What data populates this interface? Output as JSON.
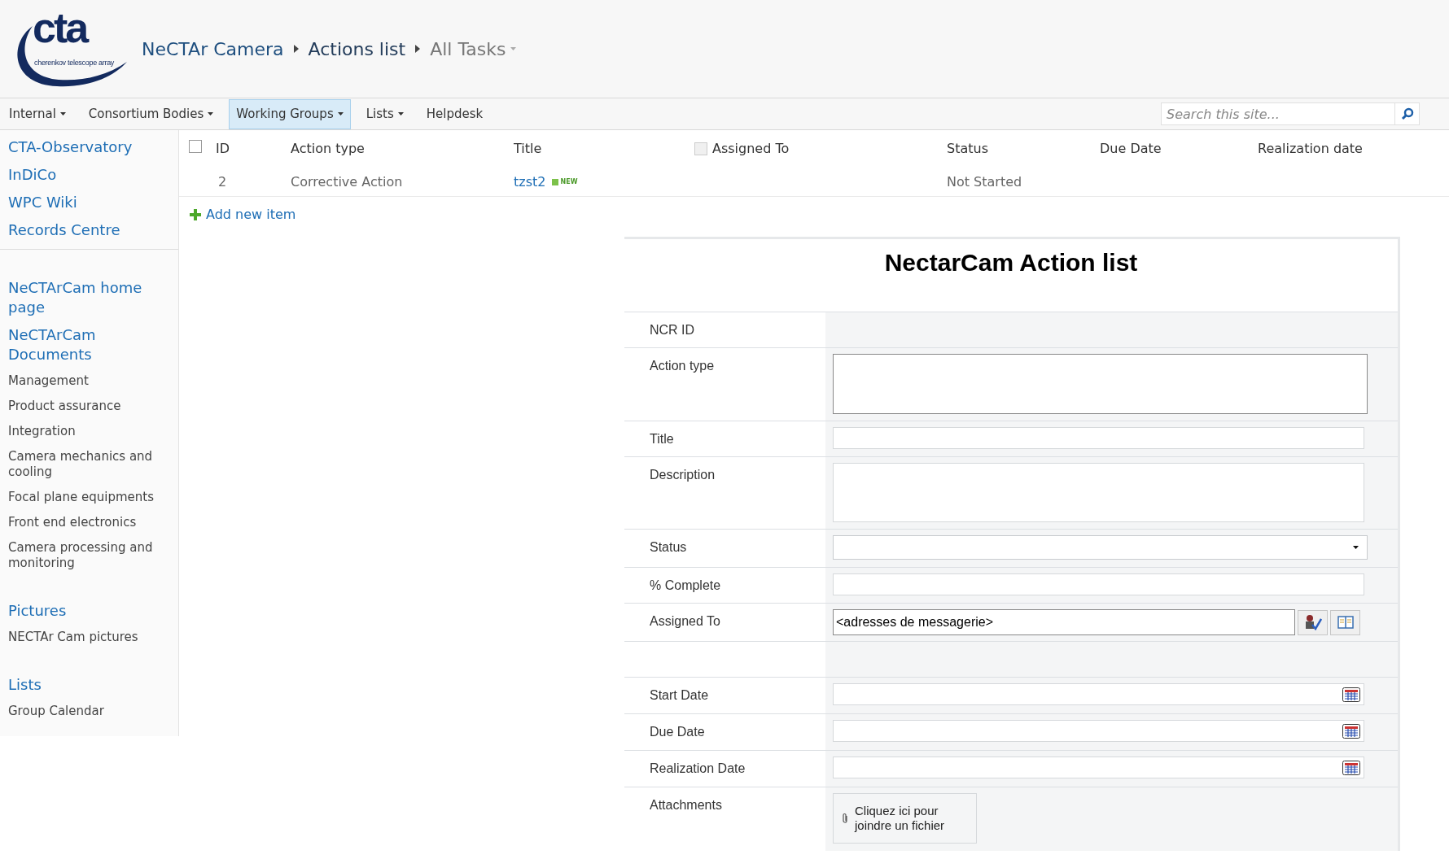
{
  "logo": {
    "mark": "cta",
    "tagline": "cherenkov telescope array"
  },
  "breadcrumb": [
    {
      "label": "NeCTAr Camera",
      "kind": "site"
    },
    {
      "label": "Actions list",
      "kind": "list"
    },
    {
      "label": "All Tasks",
      "kind": "view"
    }
  ],
  "nav": [
    {
      "label": "Internal",
      "dropdown": true,
      "selected": false
    },
    {
      "label": "Consortium Bodies",
      "dropdown": true,
      "selected": false
    },
    {
      "label": "Working Groups",
      "dropdown": true,
      "selected": true
    },
    {
      "label": "Lists",
      "dropdown": true,
      "selected": false
    },
    {
      "label": "Helpdesk",
      "dropdown": false,
      "selected": false
    }
  ],
  "search": {
    "placeholder": "Search this site..."
  },
  "sidebar": [
    {
      "items": [
        {
          "label": "CTA-Observatory",
          "kind": "heading"
        },
        {
          "label": "InDiCo",
          "kind": "heading"
        },
        {
          "label": "WPC Wiki",
          "kind": "heading"
        },
        {
          "label": "Records Centre",
          "kind": "heading"
        }
      ]
    },
    {
      "items": [
        {
          "label": "NeCTArCam home page",
          "kind": "heading"
        },
        {
          "label": "NeCTArCam Documents",
          "kind": "heading"
        },
        {
          "label": "Management",
          "kind": "link"
        },
        {
          "label": "Product assurance",
          "kind": "link"
        },
        {
          "label": "Integration",
          "kind": "link"
        },
        {
          "label": "Camera mechanics and cooling",
          "kind": "link"
        },
        {
          "label": "Focal plane equipments",
          "kind": "link"
        },
        {
          "label": "Front end electronics",
          "kind": "link"
        },
        {
          "label": "Camera processing and monitoring",
          "kind": "link"
        }
      ]
    },
    {
      "items": [
        {
          "label": "Pictures",
          "kind": "heading"
        },
        {
          "label": "NECTAr Cam pictures",
          "kind": "link"
        }
      ]
    },
    {
      "items": [
        {
          "label": "Lists",
          "kind": "heading"
        },
        {
          "label": "Group Calendar",
          "kind": "link"
        }
      ]
    }
  ],
  "table": {
    "columns": [
      {
        "label": "ID",
        "kind": "checkbox",
        "checked": false
      },
      {
        "label": "Action type",
        "kind": "plain"
      },
      {
        "label": "Title",
        "kind": "plain"
      },
      {
        "label": "Assigned To",
        "kind": "checkbox",
        "checked": false
      },
      {
        "label": "Status",
        "kind": "plain"
      },
      {
        "label": "Due Date",
        "kind": "plain"
      },
      {
        "label": "Realization date",
        "kind": "plain"
      }
    ],
    "rows": [
      {
        "id": "2",
        "action_type": "Corrective Action",
        "title": "tzst2",
        "new_badge": "NEW",
        "status": "Not Started"
      }
    ],
    "add_item": "Add new item"
  },
  "form": {
    "title": "NectarCam Action list",
    "fields": [
      {
        "label": "NCR ID",
        "kind": "static"
      },
      {
        "label": "Action type",
        "kind": "textarea"
      },
      {
        "label": "Title",
        "kind": "text"
      },
      {
        "label": "Description",
        "kind": "memo"
      },
      {
        "label": "Status",
        "kind": "select"
      },
      {
        "label": "% Complete",
        "kind": "text"
      },
      {
        "label": "Assigned To",
        "kind": "people",
        "value": "<adresses de messagerie>"
      },
      {
        "kind": "spacer"
      },
      {
        "label": "Start Date",
        "kind": "date"
      },
      {
        "label": "Due Date",
        "kind": "date"
      },
      {
        "label": "Realization Date",
        "kind": "date"
      },
      {
        "label": "Attachments",
        "kind": "attachment",
        "button": "Cliquez ici pour joindre un fichier"
      }
    ]
  }
}
